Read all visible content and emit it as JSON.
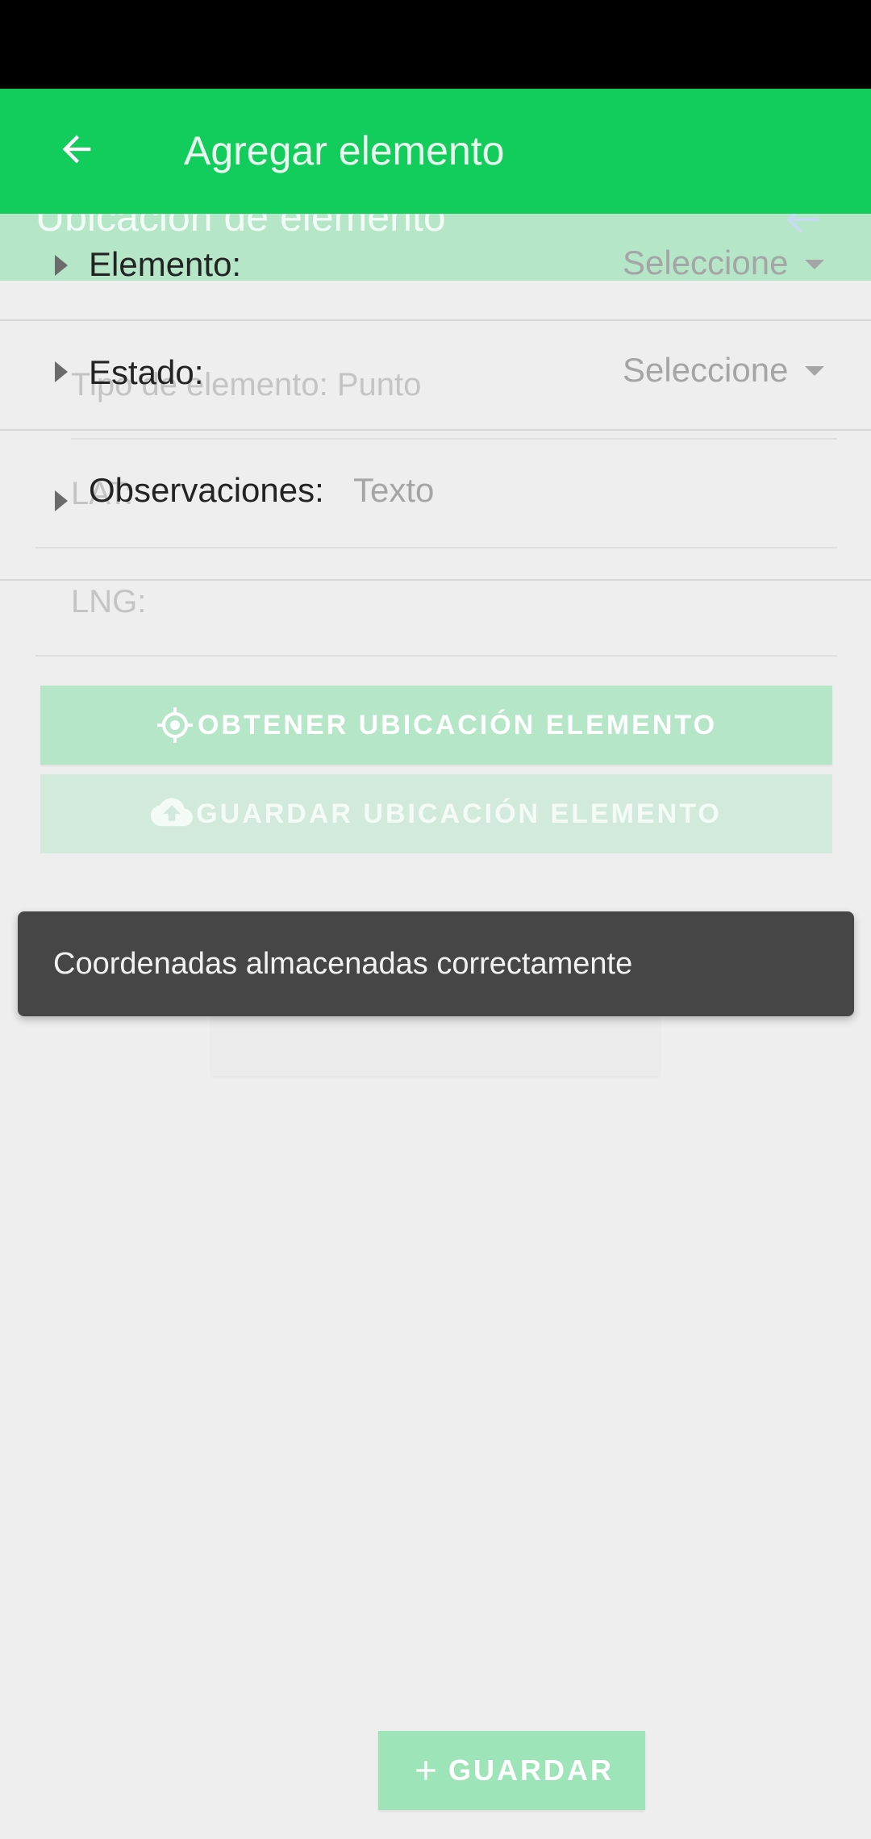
{
  "app_bar": {
    "title": "Agregar elemento",
    "back_icon": "arrow-left-icon",
    "color": "#12cd5c"
  },
  "underlay": {
    "title": "Ubicación de elemento",
    "tipo": "Tipo de elemento: Punto",
    "lat_label": "LAT:",
    "lng_label": "LNG:",
    "btn_obtener": "OBTENER UBICACIÓN ELEMENTO",
    "btn_guardar": "GUARDAR UBICACIÓN ELEMENTO"
  },
  "form": {
    "elemento": {
      "label": "Elemento:",
      "value": "Seleccione"
    },
    "estado": {
      "label": "Estado:",
      "value": "Seleccione"
    },
    "observaciones": {
      "label": "Observaciones:",
      "placeholder": "Texto"
    }
  },
  "snackbar": {
    "message": "Coordenadas almacenadas correctamente"
  },
  "footer": {
    "save_label": "GUARDAR",
    "save_icon": "plus-icon"
  }
}
